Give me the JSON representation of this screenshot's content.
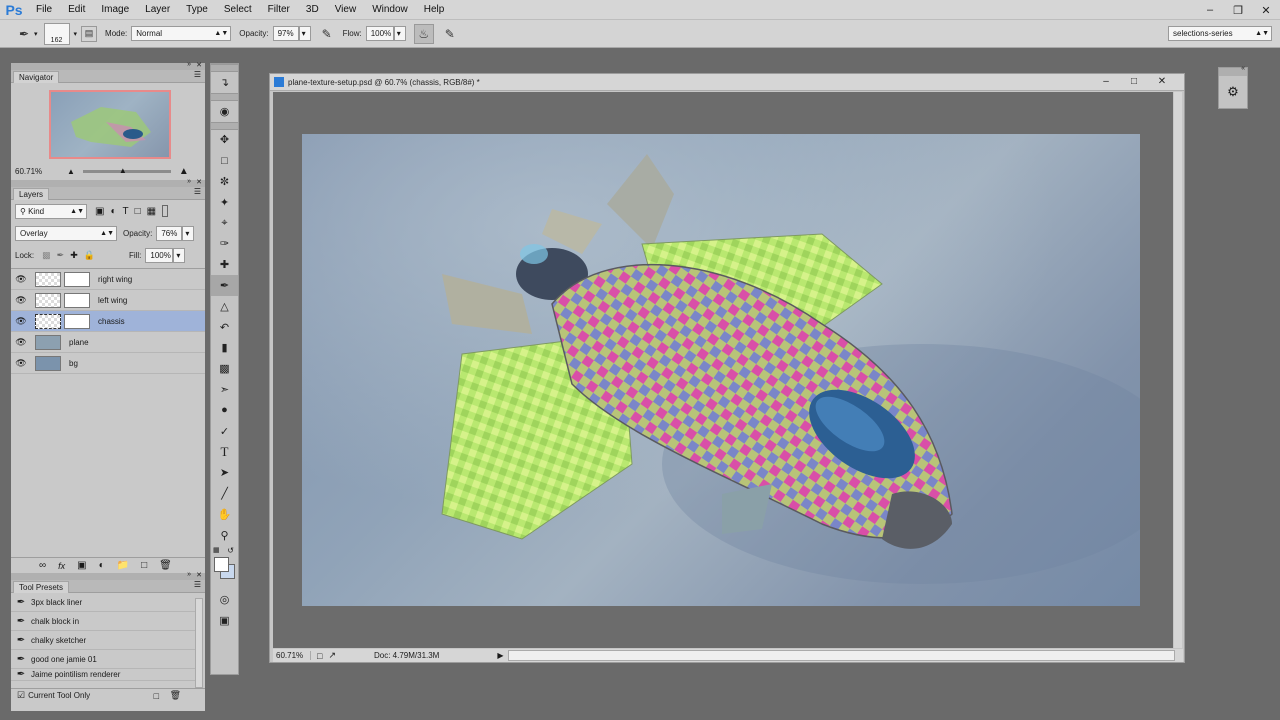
{
  "menubar": {
    "logo": "Ps",
    "items": [
      "File",
      "Edit",
      "Image",
      "Layer",
      "Type",
      "Select",
      "Filter",
      "3D",
      "View",
      "Window",
      "Help"
    ]
  },
  "options": {
    "brush_size": "162",
    "mode_label": "Mode:",
    "mode_value": "Normal",
    "opacity_label": "Opacity:",
    "opacity_value": "97%",
    "flow_label": "Flow:",
    "flow_value": "100%",
    "workspace": "selections-series"
  },
  "navigator": {
    "title": "Navigator",
    "zoom": "60.71%"
  },
  "layers": {
    "title": "Layers",
    "filter_kind": "Kind",
    "blend_mode": "Overlay",
    "opacity_label": "Opacity:",
    "opacity_value": "76%",
    "lock_label": "Lock:",
    "fill_label": "Fill:",
    "fill_value": "100%",
    "rows": [
      {
        "name": "right wing"
      },
      {
        "name": "left wing"
      },
      {
        "name": "chassis"
      },
      {
        "name": "plane"
      },
      {
        "name": "bg"
      }
    ]
  },
  "presets": {
    "title": "Tool Presets",
    "items": [
      "3px black liner",
      "chalk block in",
      "chalky sketcher",
      "good one jamie 01",
      "Jaime pointilism renderer"
    ],
    "current_only": "Current Tool Only"
  },
  "document": {
    "title": "plane-texture-setup.psd @ 60.7% (chassis, RGB/8#) *",
    "zoom": "60.71%",
    "doc_info": "Doc: 4.79M/31.3M"
  },
  "colors": {
    "foreground": "#ffffff",
    "background": "#c8d8ee",
    "selection": "#9fb3d9",
    "ps_blue": "#2b7bd6"
  },
  "icons": {
    "tools": [
      "move-icon",
      "marquee-icon",
      "lasso-icon",
      "quick-select-icon",
      "crop-icon",
      "eyedropper-icon",
      "healing-icon",
      "brush-icon",
      "stamp-icon",
      "history-brush-icon",
      "eraser-icon",
      "gradient-icon",
      "blur-icon",
      "dodge-icon",
      "pen-icon",
      "type-icon",
      "path-select-icon",
      "line-icon",
      "hand-icon",
      "zoom-icon"
    ]
  }
}
